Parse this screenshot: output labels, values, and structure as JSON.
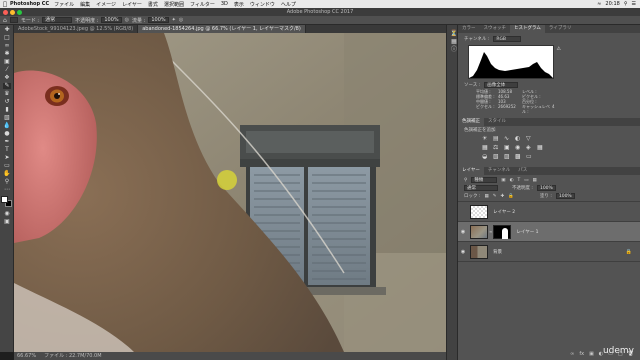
{
  "menubar": {
    "app_name": "Photoshop CC",
    "items": [
      "ファイル",
      "編集",
      "イメージ",
      "レイヤー",
      "書式",
      "選択範囲",
      "フィルター",
      "3D",
      "表示",
      "ウィンドウ",
      "ヘルプ"
    ],
    "clock": "20:18"
  },
  "window": {
    "title": "Adobe Photoshop CC 2017"
  },
  "options_bar": {
    "mode_label": "モード :",
    "mode_value": "通常",
    "opacity_label": "不透明度 :",
    "opacity_value": "100%",
    "flow_label": "流量 :",
    "flow_value": "100%"
  },
  "doc_tabs": [
    {
      "label": "AdobeStock_99104123.jpeg @ 12.5% (RGB/8)",
      "active": false
    },
    {
      "label": "abandoned-1854264.jpg @ 66.7% (レイヤー 1, レイヤーマスク/8)",
      "active": true
    }
  ],
  "status_bar": {
    "zoom": "66.67%",
    "doc_info": "ファイル : 22.7M/70.0M"
  },
  "histogram_panel": {
    "tabs": [
      "カラー",
      "スウォッチ",
      "ヒストグラム",
      "ライブラリ"
    ],
    "active_tab": "ヒストグラム",
    "channel_label": "チャンネル :",
    "channel_value": "RGB",
    "source_label": "ソース :",
    "source_value": "画像全体",
    "stats": [
      [
        "平均値 :",
        "108.58",
        "レベル :",
        ""
      ],
      [
        "標準偏差 :",
        "46.63",
        "ピクセル :",
        ""
      ],
      [
        "中間値 :",
        "103",
        "百分位 :",
        ""
      ],
      [
        "ピクセル :",
        "2669252",
        "キャッシュレベル :",
        "4"
      ]
    ]
  },
  "adjustments_panel": {
    "tabs": [
      "色調補正",
      "スタイル"
    ],
    "active_tab": "色調補正",
    "subtitle": "色調補正を追加"
  },
  "layers_panel": {
    "tabs": [
      "レイヤー",
      "チャンネル",
      "パス"
    ],
    "active_tab": "レイヤー",
    "kind_value": "種類",
    "blend_value": "通常",
    "opacity_label": "不透明度 :",
    "opacity_value": "100%",
    "lock_label": "ロック :",
    "fill_label": "塗り :",
    "fill_value": "100%",
    "layers": [
      {
        "name": "レイヤー 2",
        "visible": false,
        "selected": false,
        "has_mask": false
      },
      {
        "name": "レイヤー 1",
        "visible": true,
        "selected": true,
        "has_mask": true
      },
      {
        "name": "背景",
        "visible": true,
        "selected": false,
        "has_mask": false
      }
    ]
  },
  "watermark": "udemy"
}
